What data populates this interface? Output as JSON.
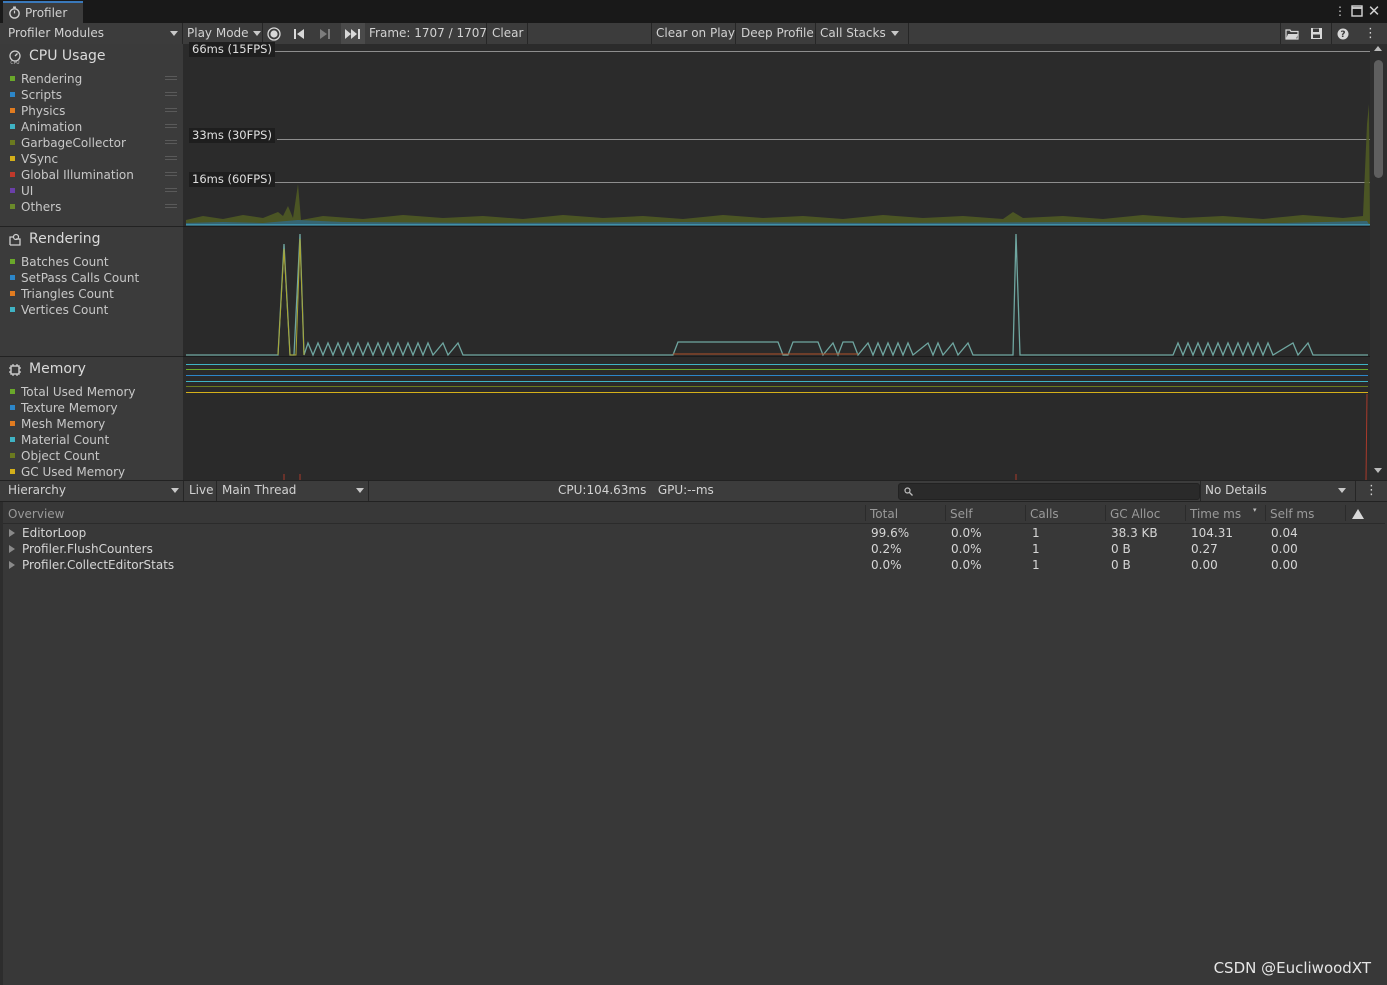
{
  "window": {
    "tab_title": "Profiler"
  },
  "toolbar": {
    "modules_label": "Profiler Modules",
    "play_mode_label": "Play Mode",
    "frame_label": "Frame: 1707 / 1707",
    "clear_label": "Clear",
    "clear_on_play_label": "Clear on Play",
    "deep_profile_label": "Deep Profile",
    "call_stacks_label": "Call Stacks"
  },
  "modules": {
    "cpu": {
      "title": "CPU Usage",
      "items": [
        {
          "label": "Rendering",
          "color": "#6aa82a"
        },
        {
          "label": "Scripts",
          "color": "#2c86c8"
        },
        {
          "label": "Physics",
          "color": "#e07b20"
        },
        {
          "label": "Animation",
          "color": "#3fb3c4"
        },
        {
          "label": "GarbageCollector",
          "color": "#6b7a1f"
        },
        {
          "label": "VSync",
          "color": "#d4b01a"
        },
        {
          "label": "Global Illumination",
          "color": "#c0392b"
        },
        {
          "label": "UI",
          "color": "#6a3fa8"
        },
        {
          "label": "Others",
          "color": "#6a8a2a"
        }
      ]
    },
    "rendering": {
      "title": "Rendering",
      "items": [
        {
          "label": "Batches Count",
          "color": "#6aa82a"
        },
        {
          "label": "SetPass Calls Count",
          "color": "#2c86c8"
        },
        {
          "label": "Triangles Count",
          "color": "#e07b20"
        },
        {
          "label": "Vertices Count",
          "color": "#3fb3c4"
        }
      ]
    },
    "memory": {
      "title": "Memory",
      "items": [
        {
          "label": "Total Used Memory",
          "color": "#6aa82a"
        },
        {
          "label": "Texture Memory",
          "color": "#2c86c8"
        },
        {
          "label": "Mesh Memory",
          "color": "#e07b20"
        },
        {
          "label": "Material Count",
          "color": "#3fb3c4"
        },
        {
          "label": "Object Count",
          "color": "#6b7a1f"
        },
        {
          "label": "GC Used Memory",
          "color": "#d4b01a"
        }
      ]
    }
  },
  "cpu_chart": {
    "fps_lines": [
      "66ms (15FPS)",
      "33ms (30FPS)",
      "16ms (60FPS)"
    ]
  },
  "details": {
    "view_label": "Hierarchy",
    "live_label": "Live",
    "thread_label": "Main Thread",
    "cpu_gpu_label": "CPU:104.63ms   GPU:--ms",
    "details_select": "No Details"
  },
  "table": {
    "columns": [
      "Overview",
      "Total",
      "Self",
      "Calls",
      "GC Alloc",
      "Time ms",
      "Self ms"
    ],
    "rows": [
      {
        "name": "EditorLoop",
        "total": "99.6%",
        "self": "0.0%",
        "calls": "1",
        "gc_alloc": "38.3 KB",
        "time_ms": "104.31",
        "self_ms": "0.04"
      },
      {
        "name": "Profiler.FlushCounters",
        "total": "0.2%",
        "self": "0.0%",
        "calls": "1",
        "gc_alloc": "0 B",
        "time_ms": "0.27",
        "self_ms": "0.00"
      },
      {
        "name": "Profiler.CollectEditorStats",
        "total": "0.0%",
        "self": "0.0%",
        "calls": "1",
        "gc_alloc": "0 B",
        "time_ms": "0.00",
        "self_ms": "0.00"
      }
    ]
  },
  "watermark": "CSDN @EucliwoodXT"
}
